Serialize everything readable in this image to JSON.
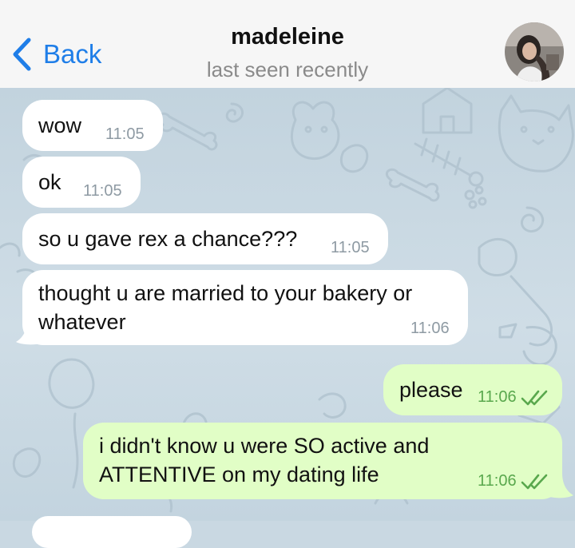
{
  "header": {
    "back_label": "Back",
    "contact_name": "madeleine",
    "status": "last seen recently"
  },
  "messages": [
    {
      "direction": "incoming",
      "lines": [
        "wow"
      ],
      "time": "11:05"
    },
    {
      "direction": "incoming",
      "lines": [
        "ok"
      ],
      "time": "11:05"
    },
    {
      "direction": "incoming",
      "lines": [
        "so u gave rex a chance???"
      ],
      "time": "11:05"
    },
    {
      "direction": "incoming",
      "lines": [
        "thought u are married to your bakery or",
        "whatever"
      ],
      "time": "11:06"
    },
    {
      "direction": "outgoing",
      "lines": [
        "please"
      ],
      "time": "11:06",
      "status": "read"
    },
    {
      "direction": "outgoing",
      "lines": [
        "i didn't know u were SO active and",
        "ATTENTIVE on my dating life"
      ],
      "time": "11:06",
      "status": "read"
    }
  ],
  "colors": {
    "accent": "#1f7ee8",
    "incoming_bubble": "#ffffff",
    "outgoing_bubble": "#e1fec6",
    "read_check": "#59a84d"
  },
  "icons": {
    "back": "chevron-left-icon",
    "read_receipt": "double-check-icon"
  }
}
